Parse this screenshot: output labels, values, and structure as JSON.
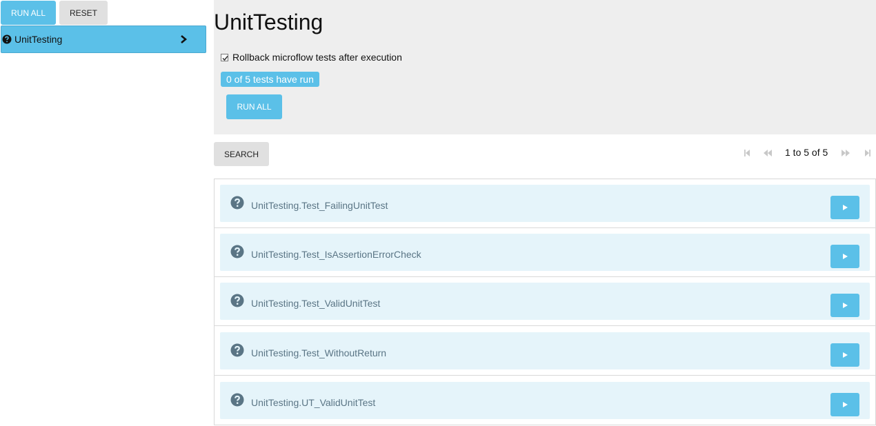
{
  "sidebar": {
    "run_all_label": "RUN ALL",
    "reset_label": "RESET",
    "module": {
      "label": "UnitTesting"
    }
  },
  "header": {
    "title": "UnitTesting",
    "rollback_label": "Rollback microflow tests after execution",
    "rollback_checked": true,
    "status_badge": "0 of 5 tests have run",
    "run_all_label": "RUN ALL"
  },
  "search": {
    "label": "SEARCH"
  },
  "pager": {
    "text": "1 to 5 of 5"
  },
  "tests": [
    {
      "name": "UnitTesting.Test_FailingUnitTest"
    },
    {
      "name": "UnitTesting.Test_IsAssertionErrorCheck"
    },
    {
      "name": "UnitTesting.Test_ValidUnitTest"
    },
    {
      "name": "UnitTesting.Test_WithoutReturn"
    },
    {
      "name": "UnitTesting.UT_ValidUnitTest"
    }
  ],
  "colors": {
    "accent": "#5bc0e8",
    "panel": "#eeeeee",
    "card": "#e5f4fa",
    "test_text": "#5a7585"
  }
}
